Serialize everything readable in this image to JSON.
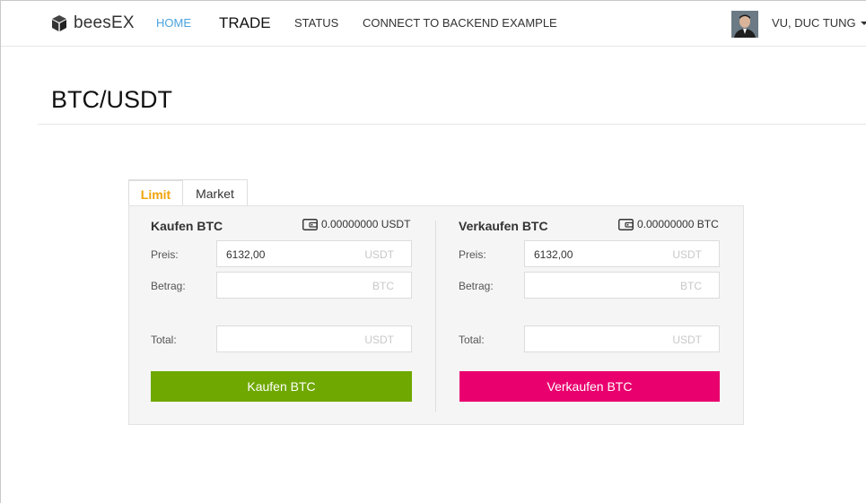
{
  "navbar": {
    "brand": "beesEX",
    "items": [
      {
        "label": "HOME"
      },
      {
        "label": "TRADE"
      },
      {
        "label": "STATUS"
      },
      {
        "label": "CONNECT TO BACKEND EXAMPLE"
      }
    ],
    "user_name": "VU, DUC TUNG"
  },
  "page": {
    "title": "BTC/USDT"
  },
  "tabs": [
    {
      "label": "Limit",
      "active": true
    },
    {
      "label": "Market",
      "active": false
    }
  ],
  "buy": {
    "title": "Kaufen BTC",
    "balance": "0.00000000 USDT",
    "price_label": "Preis:",
    "price_value": "6132,00",
    "price_unit": "USDT",
    "amount_label": "Betrag:",
    "amount_value": "",
    "amount_unit": "BTC",
    "total_label": "Total:",
    "total_value": "",
    "total_unit": "USDT",
    "button_label": "Kaufen BTC"
  },
  "sell": {
    "title": "Verkaufen BTC",
    "balance": "0.00000000 BTC",
    "price_label": "Preis:",
    "price_value": "6132,00",
    "price_unit": "USDT",
    "amount_label": "Betrag:",
    "amount_value": "",
    "amount_unit": "BTC",
    "total_label": "Total:",
    "total_value": "",
    "total_unit": "USDT",
    "button_label": "Verkaufen BTC"
  },
  "colors": {
    "accent_link": "#4aa3df",
    "active_tab": "#f0a30a",
    "buy_button": "#6fa800",
    "sell_button": "#e9006e"
  },
  "icons": {
    "brand": "cube-icon",
    "balance": "wallet-icon",
    "user_menu": "caret-down-icon"
  }
}
